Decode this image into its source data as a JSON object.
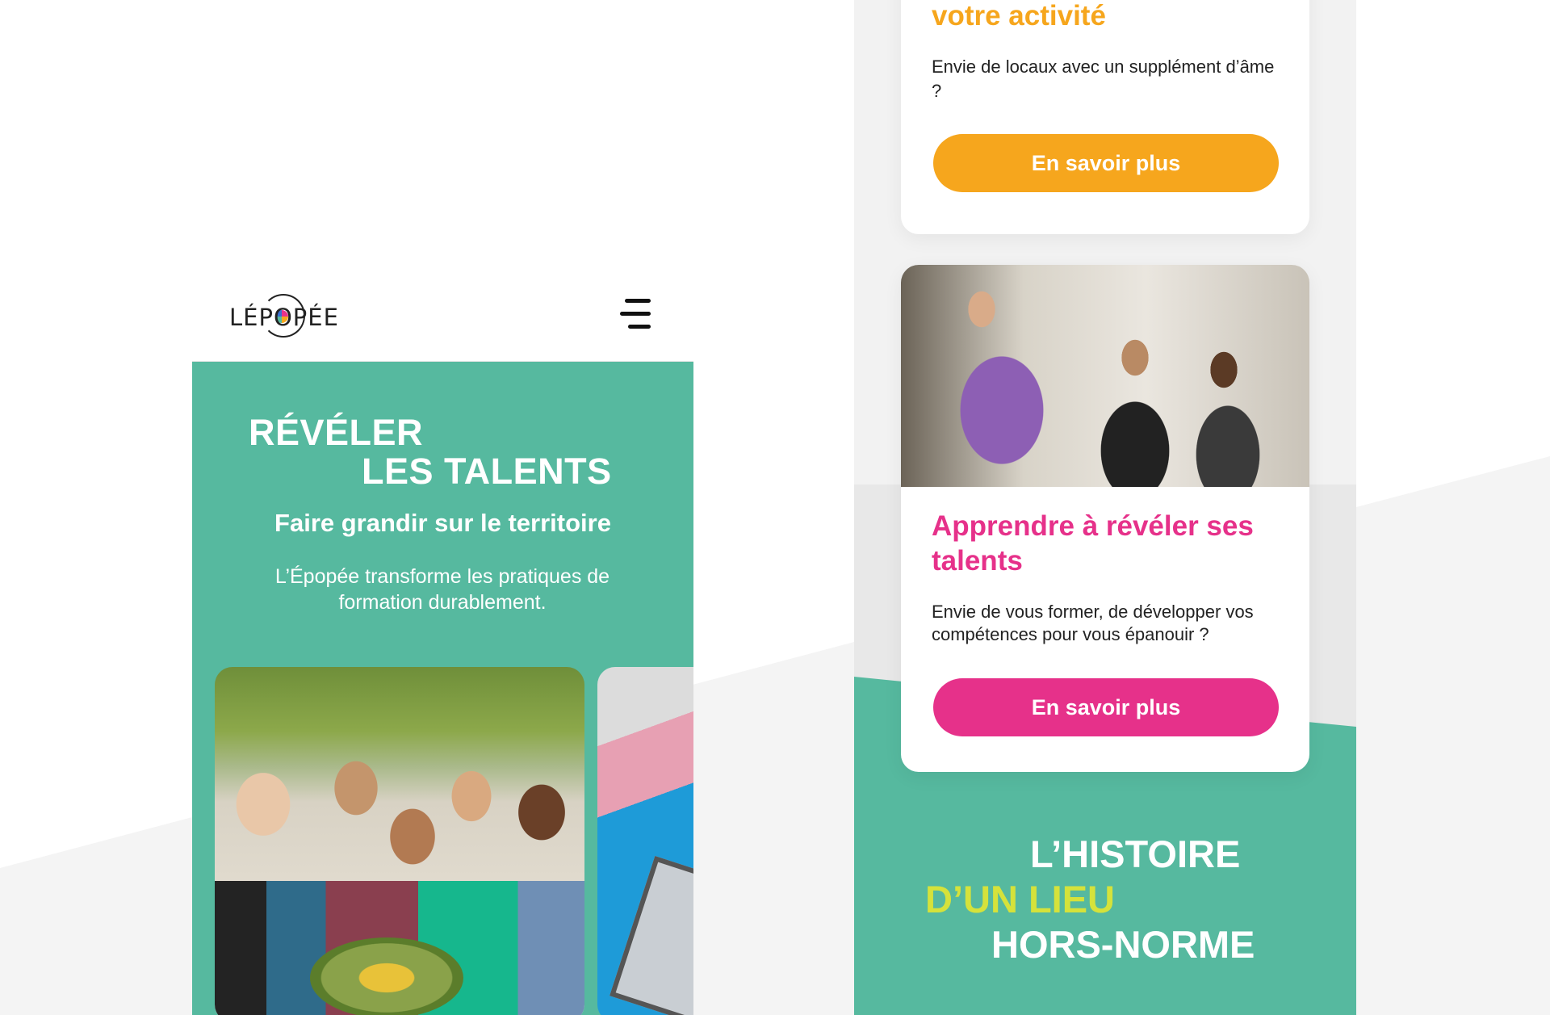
{
  "left_phone": {
    "logo": {
      "text": "LÉPOPÉE",
      "icon": "epopee-logo-icon"
    },
    "menu": {
      "icon": "hamburger-menu-icon"
    },
    "hero": {
      "title_line1": "RÉVÉLER",
      "title_line2": "LES TALENTS",
      "subtitle": "Faire grandir sur le territoire",
      "description": "L’Épopée transforme les pratiques de formation durablement."
    },
    "carousel": {
      "photos": [
        "group-of-women-photo",
        "electronics-repair-photo"
      ]
    }
  },
  "right_phone": {
    "card_activity": {
      "title": "votre activité",
      "text": "Envie de locaux avec un supplément d’âme ?",
      "button": "En savoir plus"
    },
    "card_talents": {
      "title": "Apprendre à révéler ses talents",
      "text": "Envie de vous former, de développer vos compétences pour vous épanouir ?",
      "button": "En savoir plus",
      "photo": "training-class-photo"
    },
    "history": {
      "line1": "L’HISTOIRE",
      "line2": "D’UN LIEU",
      "line3": "HORS-NORME"
    }
  },
  "colors": {
    "green": "#56b99f",
    "orange": "#f6a61d",
    "pink": "#e6318a",
    "lime": "#d5e23b"
  }
}
